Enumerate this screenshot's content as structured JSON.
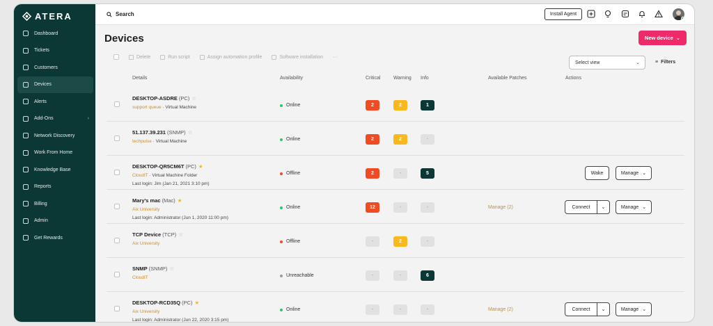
{
  "brand": {
    "name": "ATERA"
  },
  "sidebar": {
    "items": [
      {
        "label": "Dashboard",
        "icon": "grid-icon",
        "active": false
      },
      {
        "label": "Tickets",
        "icon": "ticket-icon",
        "active": false
      },
      {
        "label": "Customers",
        "icon": "customers-icon",
        "active": false
      },
      {
        "label": "Devices",
        "icon": "monitor-icon",
        "active": true
      },
      {
        "label": "Alerts",
        "icon": "alert-icon",
        "active": false
      },
      {
        "label": "Add-Ons",
        "icon": "addons-icon",
        "active": false,
        "chevron": "›"
      },
      {
        "label": "Network Discovery",
        "icon": "network-icon",
        "active": false
      },
      {
        "label": "Work From Home",
        "icon": "home-icon",
        "active": false
      },
      {
        "label": "Knowledge Base",
        "icon": "book-icon",
        "active": false
      },
      {
        "label": "Reports",
        "icon": "reports-icon",
        "active": false
      },
      {
        "label": "Billing",
        "icon": "billing-icon",
        "active": false
      },
      {
        "label": "Admin",
        "icon": "admin-icon",
        "active": false
      },
      {
        "label": "Get Rewards",
        "icon": "gift-icon",
        "active": false
      }
    ]
  },
  "topbar": {
    "search_label": "Search",
    "install_label": "Install Agent"
  },
  "page": {
    "title": "Devices",
    "new_device_label": "New device",
    "toolbar": {
      "delete": "Delete",
      "run_script": "Run script",
      "assign_profile": "Assign automation profile",
      "software_installation": "Software installation",
      "more": "···"
    },
    "select_view_placeholder": "Select view",
    "filters_label": "Filters"
  },
  "columns": {
    "details": "Details",
    "availability": "Availability",
    "critical": "Critical",
    "warning": "Warning",
    "info": "Info",
    "patches": "Available Patches",
    "actions": "Actions"
  },
  "devices": [
    {
      "name": "DESKTOP-ASDRE",
      "type": "(PC)",
      "starred": false,
      "org": "support queue",
      "sub": " · Virtual Machine",
      "login": "",
      "availability": "Online",
      "critical": "2",
      "warning": "2",
      "info": "1",
      "patches": "",
      "wake": false,
      "connect": false,
      "manage": false
    },
    {
      "name": "51.137.39.231",
      "type": "(SNMP)",
      "starred": false,
      "org": "techpulse",
      "sub": " · Virtual Machine",
      "login": "",
      "availability": "Online",
      "critical": "2",
      "warning": "2",
      "info": "-",
      "patches": "",
      "wake": false,
      "connect": false,
      "manage": false
    },
    {
      "name": "DESKTOP-QR5CM6T",
      "type": "(PC)",
      "starred": true,
      "org": "CloudIT",
      "sub": " · Virtual Machine Folder",
      "login": "Last login: Jim (Jan 21, 2021 3:10 pm)",
      "availability": "Offline",
      "critical": "2",
      "warning": "-",
      "info": "5",
      "patches": "",
      "wake": true,
      "connect": false,
      "manage": true
    },
    {
      "name": "Mary's mac",
      "type": "(Mac)",
      "starred": true,
      "org": "Aix University",
      "sub": "",
      "login": "Last login: Administrator (Jun 1, 2020 11:00 pm)",
      "availability": "Online",
      "critical": "12",
      "warning": "-",
      "info": "-",
      "patches": "Manage (2)",
      "wake": false,
      "connect": true,
      "manage": true
    },
    {
      "name": "TCP Device",
      "type": "(TCP)",
      "starred": false,
      "org": "Aix University",
      "sub": "",
      "login": "",
      "availability": "Offline",
      "critical": "-",
      "warning": "2",
      "info": "-",
      "patches": "",
      "wake": false,
      "connect": false,
      "manage": false
    },
    {
      "name": "SNMP",
      "type": "(SNMP)",
      "starred": false,
      "org": "CloudIT",
      "sub": "",
      "login": "",
      "availability": "Unreachable",
      "critical": "-",
      "warning": "-",
      "info": "6",
      "patches": "",
      "wake": false,
      "connect": false,
      "manage": false
    },
    {
      "name": "DESKTOP-RCD35Q",
      "type": "(PC)",
      "starred": true,
      "org": "Aix University",
      "sub": "",
      "login": "Last login: Administrator (Jun 22, 2020 3:15 pm)",
      "availability": "Online",
      "critical": "-",
      "warning": "-",
      "info": "-",
      "patches": "Manage (2)",
      "wake": false,
      "connect": true,
      "manage": true
    }
  ],
  "labels": {
    "wake": "Wake",
    "connect": "Connect",
    "manage": "Manage"
  },
  "colors": {
    "sidebar": "#0b3734",
    "accent": "#ee2a6b",
    "critical": "#f04b23",
    "warning": "#f9b81c",
    "info": "#0b3734",
    "online": "#2ec46a",
    "offline": "#f04b23",
    "unreachable": "#9a9a9a"
  }
}
